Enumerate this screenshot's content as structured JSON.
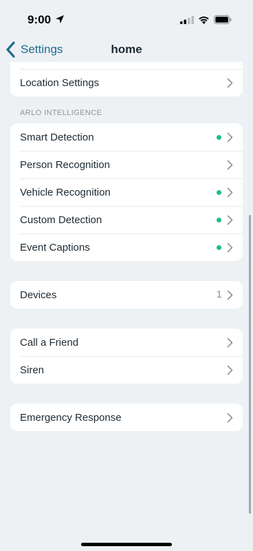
{
  "status_bar": {
    "time": "9:00",
    "icons": [
      "location-arrow-icon",
      "cellular-signal-icon",
      "wifi-icon",
      "battery-icon"
    ]
  },
  "nav": {
    "back_label": "Settings",
    "title": "home"
  },
  "sections": {
    "location": {
      "items": [
        {
          "label": "Location Settings"
        }
      ]
    },
    "arlo_intelligence": {
      "header": "ARLO INTELLIGENCE",
      "items": [
        {
          "label": "Smart Detection",
          "status_dot": true
        },
        {
          "label": "Person Recognition",
          "status_dot": false
        },
        {
          "label": "Vehicle Recognition",
          "status_dot": true
        },
        {
          "label": "Custom Detection",
          "status_dot": true
        },
        {
          "label": "Event Captions",
          "status_dot": true
        }
      ]
    },
    "devices": {
      "items": [
        {
          "label": "Devices",
          "count": "1"
        }
      ]
    },
    "safety": {
      "items": [
        {
          "label": "Call a Friend"
        },
        {
          "label": "Siren"
        }
      ]
    },
    "emergency": {
      "items": [
        {
          "label": "Emergency Response"
        }
      ]
    }
  },
  "colors": {
    "background": "#edf1f4",
    "accent": "#1f6a8f",
    "status_dot": "#1dbf8c"
  }
}
